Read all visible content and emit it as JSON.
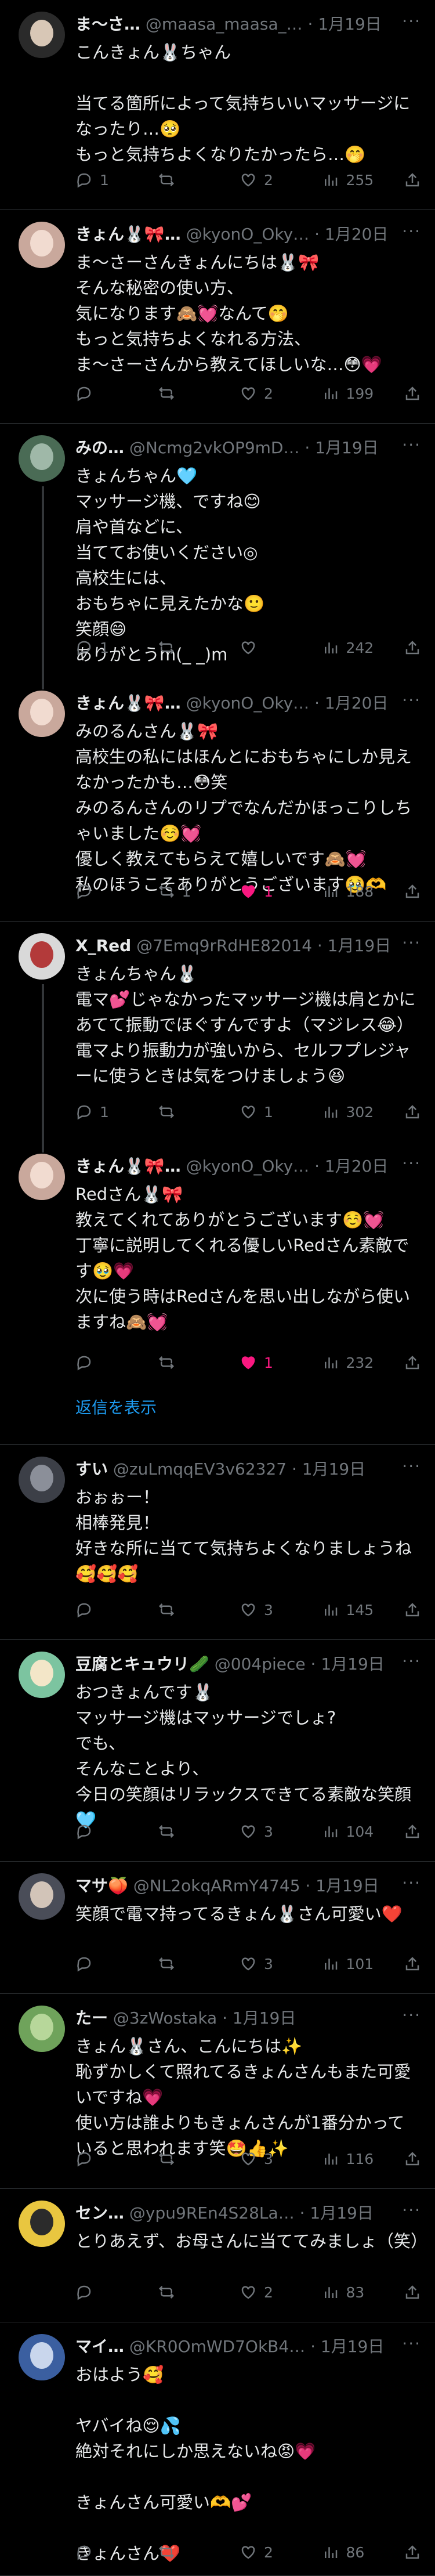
{
  "tweets": [
    {
      "name": "ま〜さ…",
      "handle": "@maasa_maasa_…",
      "date": "1月19日",
      "text": "こんきょん🐰ちゃん\n\n当てる箇所によって気持ちいいマッサージになったり…🥺\nもっと気持ちよくなりたかったら…🤭",
      "replies": "1",
      "retweets": "",
      "likes": "2",
      "views": "255",
      "liked": false,
      "avatar_colors": [
        "#2a2a2a",
        "#d8c7b6"
      ]
    },
    {
      "name": "きょん🐰🎀…",
      "handle": "@kyonO_Oky…",
      "date": "1月20日",
      "text": "ま〜さーさんきょんにちは🐰🎀\nそんな秘密の使い方、\n気になります🙈💓なんて🤭\nもっと気持ちよくなれる方法、\nま〜さーさんから教えてほしいな…😳💗",
      "replies": "",
      "retweets": "",
      "likes": "2",
      "views": "199",
      "liked": false,
      "avatar_colors": [
        "#c9a89c",
        "#f1dbd0"
      ]
    },
    {
      "name": "みの…",
      "handle": "@Ncmg2vkOP9mD…",
      "date": "1月19日",
      "text": "きょんちゃん🩵\nマッサージ機、ですね😊\n肩や首などに、\n当ててお使いください◎\n高校生には、\nおもちゃに見えたかな🙂\n笑顔😄\nありがとうm(_ _)m",
      "replies": "1",
      "retweets": "",
      "likes": "",
      "views": "242",
      "liked": false,
      "avatar_colors": [
        "#4a6b55",
        "#9fb8a8"
      ]
    },
    {
      "name": "きょん🐰🎀…",
      "handle": "@kyonO_Oky…",
      "date": "1月20日",
      "text": "みのるんさん🐰🎀\n高校生の私にはほんとにおもちゃにしか見えなかったかも…😳笑\nみのるんさんのリプでなんだかほっこりしちゃいました☺️💓\n優しく教えてもらえて嬉しいです🙈💓\n私のほうこそありがとうございます🥹🫶",
      "replies": "",
      "retweets": "1",
      "likes": "1",
      "views": "188",
      "liked": true,
      "avatar_colors": [
        "#c9a89c",
        "#f1dbd0"
      ]
    },
    {
      "name": "X_Red",
      "handle": "@7Emq9rRdHE82014",
      "date": "1月19日",
      "text": "きょんちゃん🐰\n電マ💕じゃなかったマッサージ機は肩とかにあてて振動でほぐすんですよ（マジレス😂）\n電マより振動力が強いから、セルフプレジャーに使うときは気をつけましょう😆",
      "replies": "1",
      "retweets": "",
      "likes": "1",
      "views": "302",
      "liked": false,
      "avatar_colors": [
        "#d9d9d9",
        "#b33a3a"
      ]
    },
    {
      "name": "きょん🐰🎀…",
      "handle": "@kyonO_Oky…",
      "date": "1月20日",
      "text": "Redさん🐰🎀\n教えてくれてありがとうございます☺️💓\n丁寧に説明してくれる優しいRedさん素敵です🥹💗\n次に使う時はRedさんを思い出しながら使いますね🙈💓",
      "replies": "",
      "retweets": "",
      "likes": "1",
      "views": "232",
      "liked": true,
      "avatar_colors": [
        "#c9a89c",
        "#f1dbd0"
      ]
    },
    {
      "name": "すい",
      "handle": "@zuLmqqEV3v62327",
      "date": "1月19日",
      "text": "おぉぉー！\n相棒発見！\n好きな所に当てて気持ちよくなりましょうね🥰🥰🥰",
      "replies": "",
      "retweets": "",
      "likes": "3",
      "views": "145",
      "liked": false,
      "avatar_colors": [
        "#3c3f47",
        "#8b8f99"
      ]
    },
    {
      "name": "豆腐とキュウリ🥒",
      "handle": "@004piece",
      "date": "1月19日",
      "text": "おつきょんです🐰\nマッサージ機はマッサージでしょ?\nでも、\nそんなことより、\n今日の笑顔はリラックスできてる素敵な笑顔🩵",
      "replies": "",
      "retweets": "",
      "likes": "3",
      "views": "104",
      "liked": false,
      "avatar_colors": [
        "#7cc4a0",
        "#f3e6c8"
      ]
    },
    {
      "name": "マサ🍑",
      "handle": "@NL2okqARmY4745",
      "date": "1月19日",
      "text": "笑顔で電マ持ってるきょん🐰さん可愛い❤️",
      "replies": "",
      "retweets": "",
      "likes": "3",
      "views": "101",
      "liked": false,
      "avatar_colors": [
        "#4a4d58",
        "#d2c4b8"
      ]
    },
    {
      "name": "たー",
      "handle": "@3zWostaka",
      "date": "1月19日",
      "text": "きょん🐰さん、こんにちは✨\n恥ずかしくて照れてるきょんさんもまた可愛いですね💗\n使い方は誰よりもきょんさんが1番分かっていると思われます笑🤩👍✨",
      "replies": "",
      "retweets": "",
      "likes": "3",
      "views": "116",
      "liked": false,
      "avatar_colors": [
        "#6fa35b",
        "#b7d79a"
      ]
    },
    {
      "name": "セン…",
      "handle": "@ypu9REn4S28La…",
      "date": "1月19日",
      "text": "とりあえず、お母さんに当ててみましょ（笑）",
      "replies": "",
      "retweets": "",
      "likes": "2",
      "views": "83",
      "liked": false,
      "avatar_colors": [
        "#e9c640",
        "#2b2b2b"
      ]
    },
    {
      "name": "マイ…",
      "handle": "@KR0OmWD7OkB4…",
      "date": "1月19日",
      "text": "おはよう🥰\n\nヤバイね😌💦\n絶対それにしか思えないね😡💗\n\nきょんさん可愛い🫶💕\n\nきょんさん❤️",
      "replies": "",
      "retweets": "",
      "likes": "2",
      "views": "86",
      "liked": false,
      "avatar_colors": [
        "#3b5fa0",
        "#c9d6ec"
      ]
    }
  ],
  "show_replies_label": "返信を表示"
}
